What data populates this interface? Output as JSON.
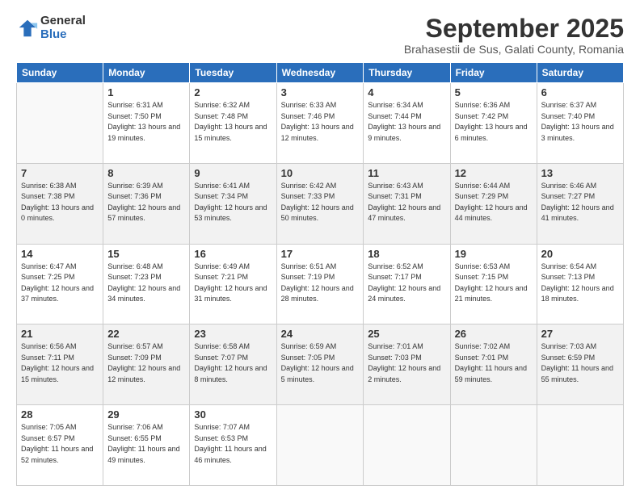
{
  "logo": {
    "general": "General",
    "blue": "Blue"
  },
  "header": {
    "month": "September 2025",
    "location": "Brahasestii de Sus, Galati County, Romania"
  },
  "weekdays": [
    "Sunday",
    "Monday",
    "Tuesday",
    "Wednesday",
    "Thursday",
    "Friday",
    "Saturday"
  ],
  "weeks": [
    [
      {
        "day": "",
        "sunrise": "",
        "sunset": "",
        "daylight": ""
      },
      {
        "day": "1",
        "sunrise": "Sunrise: 6:31 AM",
        "sunset": "Sunset: 7:50 PM",
        "daylight": "Daylight: 13 hours and 19 minutes."
      },
      {
        "day": "2",
        "sunrise": "Sunrise: 6:32 AM",
        "sunset": "Sunset: 7:48 PM",
        "daylight": "Daylight: 13 hours and 15 minutes."
      },
      {
        "day": "3",
        "sunrise": "Sunrise: 6:33 AM",
        "sunset": "Sunset: 7:46 PM",
        "daylight": "Daylight: 13 hours and 12 minutes."
      },
      {
        "day": "4",
        "sunrise": "Sunrise: 6:34 AM",
        "sunset": "Sunset: 7:44 PM",
        "daylight": "Daylight: 13 hours and 9 minutes."
      },
      {
        "day": "5",
        "sunrise": "Sunrise: 6:36 AM",
        "sunset": "Sunset: 7:42 PM",
        "daylight": "Daylight: 13 hours and 6 minutes."
      },
      {
        "day": "6",
        "sunrise": "Sunrise: 6:37 AM",
        "sunset": "Sunset: 7:40 PM",
        "daylight": "Daylight: 13 hours and 3 minutes."
      }
    ],
    [
      {
        "day": "7",
        "sunrise": "Sunrise: 6:38 AM",
        "sunset": "Sunset: 7:38 PM",
        "daylight": "Daylight: 13 hours and 0 minutes."
      },
      {
        "day": "8",
        "sunrise": "Sunrise: 6:39 AM",
        "sunset": "Sunset: 7:36 PM",
        "daylight": "Daylight: 12 hours and 57 minutes."
      },
      {
        "day": "9",
        "sunrise": "Sunrise: 6:41 AM",
        "sunset": "Sunset: 7:34 PM",
        "daylight": "Daylight: 12 hours and 53 minutes."
      },
      {
        "day": "10",
        "sunrise": "Sunrise: 6:42 AM",
        "sunset": "Sunset: 7:33 PM",
        "daylight": "Daylight: 12 hours and 50 minutes."
      },
      {
        "day": "11",
        "sunrise": "Sunrise: 6:43 AM",
        "sunset": "Sunset: 7:31 PM",
        "daylight": "Daylight: 12 hours and 47 minutes."
      },
      {
        "day": "12",
        "sunrise": "Sunrise: 6:44 AM",
        "sunset": "Sunset: 7:29 PM",
        "daylight": "Daylight: 12 hours and 44 minutes."
      },
      {
        "day": "13",
        "sunrise": "Sunrise: 6:46 AM",
        "sunset": "Sunset: 7:27 PM",
        "daylight": "Daylight: 12 hours and 41 minutes."
      }
    ],
    [
      {
        "day": "14",
        "sunrise": "Sunrise: 6:47 AM",
        "sunset": "Sunset: 7:25 PM",
        "daylight": "Daylight: 12 hours and 37 minutes."
      },
      {
        "day": "15",
        "sunrise": "Sunrise: 6:48 AM",
        "sunset": "Sunset: 7:23 PM",
        "daylight": "Daylight: 12 hours and 34 minutes."
      },
      {
        "day": "16",
        "sunrise": "Sunrise: 6:49 AM",
        "sunset": "Sunset: 7:21 PM",
        "daylight": "Daylight: 12 hours and 31 minutes."
      },
      {
        "day": "17",
        "sunrise": "Sunrise: 6:51 AM",
        "sunset": "Sunset: 7:19 PM",
        "daylight": "Daylight: 12 hours and 28 minutes."
      },
      {
        "day": "18",
        "sunrise": "Sunrise: 6:52 AM",
        "sunset": "Sunset: 7:17 PM",
        "daylight": "Daylight: 12 hours and 24 minutes."
      },
      {
        "day": "19",
        "sunrise": "Sunrise: 6:53 AM",
        "sunset": "Sunset: 7:15 PM",
        "daylight": "Daylight: 12 hours and 21 minutes."
      },
      {
        "day": "20",
        "sunrise": "Sunrise: 6:54 AM",
        "sunset": "Sunset: 7:13 PM",
        "daylight": "Daylight: 12 hours and 18 minutes."
      }
    ],
    [
      {
        "day": "21",
        "sunrise": "Sunrise: 6:56 AM",
        "sunset": "Sunset: 7:11 PM",
        "daylight": "Daylight: 12 hours and 15 minutes."
      },
      {
        "day": "22",
        "sunrise": "Sunrise: 6:57 AM",
        "sunset": "Sunset: 7:09 PM",
        "daylight": "Daylight: 12 hours and 12 minutes."
      },
      {
        "day": "23",
        "sunrise": "Sunrise: 6:58 AM",
        "sunset": "Sunset: 7:07 PM",
        "daylight": "Daylight: 12 hours and 8 minutes."
      },
      {
        "day": "24",
        "sunrise": "Sunrise: 6:59 AM",
        "sunset": "Sunset: 7:05 PM",
        "daylight": "Daylight: 12 hours and 5 minutes."
      },
      {
        "day": "25",
        "sunrise": "Sunrise: 7:01 AM",
        "sunset": "Sunset: 7:03 PM",
        "daylight": "Daylight: 12 hours and 2 minutes."
      },
      {
        "day": "26",
        "sunrise": "Sunrise: 7:02 AM",
        "sunset": "Sunset: 7:01 PM",
        "daylight": "Daylight: 11 hours and 59 minutes."
      },
      {
        "day": "27",
        "sunrise": "Sunrise: 7:03 AM",
        "sunset": "Sunset: 6:59 PM",
        "daylight": "Daylight: 11 hours and 55 minutes."
      }
    ],
    [
      {
        "day": "28",
        "sunrise": "Sunrise: 7:05 AM",
        "sunset": "Sunset: 6:57 PM",
        "daylight": "Daylight: 11 hours and 52 minutes."
      },
      {
        "day": "29",
        "sunrise": "Sunrise: 7:06 AM",
        "sunset": "Sunset: 6:55 PM",
        "daylight": "Daylight: 11 hours and 49 minutes."
      },
      {
        "day": "30",
        "sunrise": "Sunrise: 7:07 AM",
        "sunset": "Sunset: 6:53 PM",
        "daylight": "Daylight: 11 hours and 46 minutes."
      },
      {
        "day": "",
        "sunrise": "",
        "sunset": "",
        "daylight": ""
      },
      {
        "day": "",
        "sunrise": "",
        "sunset": "",
        "daylight": ""
      },
      {
        "day": "",
        "sunrise": "",
        "sunset": "",
        "daylight": ""
      },
      {
        "day": "",
        "sunrise": "",
        "sunset": "",
        "daylight": ""
      }
    ]
  ]
}
